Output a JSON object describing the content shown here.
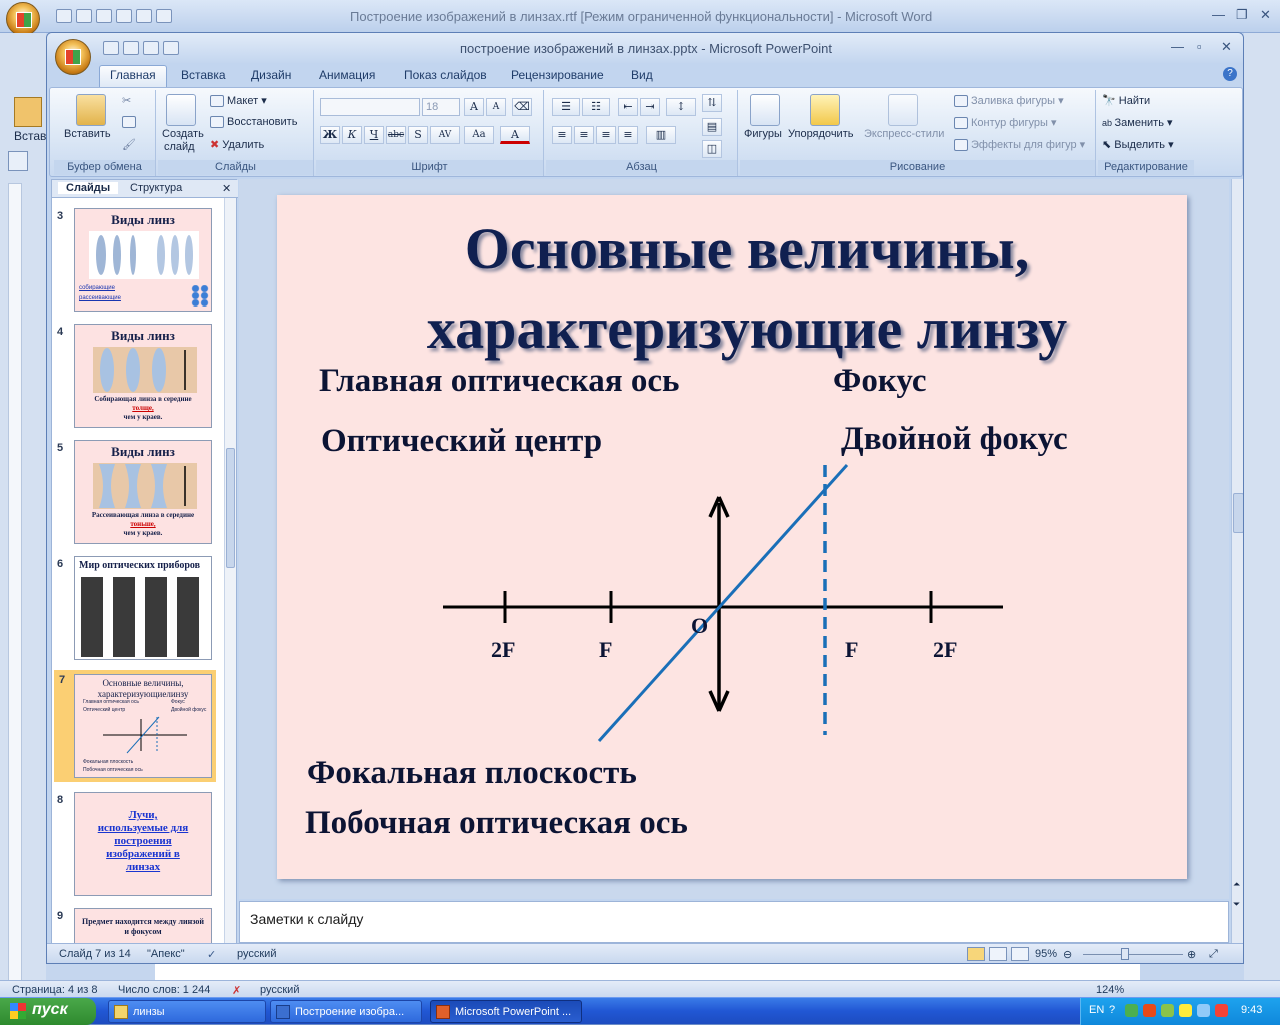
{
  "word": {
    "title": "Построение изображений в линзах.rtf [Режим ограниченной функциональности] - Microsoft Word",
    "ribbon_label": "Встав",
    "status": {
      "page": "Страница: 4 из 8",
      "words": "Число слов: 1 244",
      "lang": "русский",
      "zoom": "124%"
    }
  },
  "ppt": {
    "title": "построение изображений в линзах.pptx - Microsoft PowerPoint",
    "tabs": [
      "Главная",
      "Вставка",
      "Дизайн",
      "Анимация",
      "Показ слайдов",
      "Рецензирование",
      "Вид"
    ],
    "ribbon": {
      "clipboard": {
        "paste": "Вставить",
        "label": "Буфер обмена"
      },
      "slides": {
        "create": "Создать",
        "create2": "слайд",
        "layout": "Макет",
        "reset": "Восстановить",
        "delete": "Удалить",
        "label": "Слайды"
      },
      "font": {
        "size": "18",
        "label": "Шрифт"
      },
      "paragraph": {
        "label": "Абзац"
      },
      "drawing": {
        "shapes": "Фигуры",
        "arrange": "Упорядочить",
        "quick": "Экспресс-стили",
        "fill": "Заливка фигуры",
        "outline": "Контур фигуры",
        "effects": "Эффекты для фигур",
        "label": "Рисование"
      },
      "editing": {
        "find": "Найти",
        "replace": "Заменить",
        "select": "Выделить",
        "label": "Редактирование"
      }
    },
    "panel_tabs": {
      "slides": "Слайды",
      "outline": "Структура"
    },
    "thumbs": [
      {
        "num": "3",
        "title": "Виды линз",
        "lines": [
          "собирающие",
          "рассеивающие"
        ]
      },
      {
        "num": "4",
        "title": "Виды линз",
        "lines": [
          "Собирающая линза в середине",
          "толще,",
          "чем у краев."
        ]
      },
      {
        "num": "5",
        "title": "Виды линз",
        "lines": [
          "Рассеивающая линза в середине",
          "тоньше,",
          "чем у краев."
        ]
      },
      {
        "num": "6",
        "title": "Мир оптических приборов"
      },
      {
        "num": "7",
        "title": "Основные величины, характеризующиелинзу",
        "lines": [
          "Главная оптическая ось",
          "Фокус",
          "Оптический центр",
          "Двойной фокус",
          "Фокальная плоскость",
          "Побочная оптическая ось"
        ]
      },
      {
        "num": "8",
        "title": "Лучи, используемые для построения изображений в линзах"
      },
      {
        "num": "9",
        "title": "Предмет находится между линзой и фокусом"
      }
    ],
    "slide": {
      "title_line1": "Основные величины,",
      "title_line2": "характеризующие линзу",
      "terms": {
        "main_axis": "Главная оптическая ось",
        "focus": "Фокус",
        "optical_center": "Оптический центр",
        "double_focus": "Двойной фокус",
        "focal_plane": "Фокальная плоскость",
        "secondary_axis": "Побочная оптическая ось"
      },
      "diagram_labels": {
        "l2f": "2F",
        "lf": "F",
        "o": "O",
        "rf": "F",
        "r2f": "2F"
      }
    },
    "notes_placeholder": "Заметки к слайду",
    "status": {
      "slide": "Слайд 7 из 14",
      "theme": "\"Апекс\"",
      "lang": "русский",
      "zoom": "95%"
    }
  },
  "taskbar": {
    "start": "пуск",
    "tasks": [
      "линзы",
      "Построение изобра...",
      "Microsoft PowerPoint ..."
    ],
    "lang": "EN",
    "time": "9:43"
  },
  "colors": {
    "slide_bg": "#fde4e2",
    "title_color": "#102050",
    "line_blue": "#1a6fb8"
  }
}
